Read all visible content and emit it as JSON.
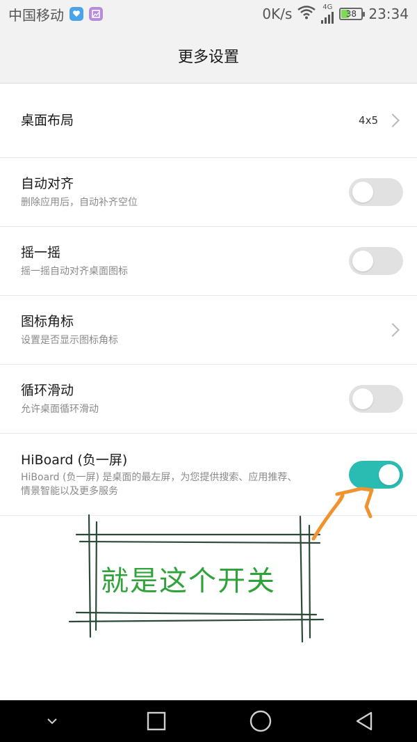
{
  "status_bar": {
    "carrier": "中国移动",
    "network_speed": "0K/s",
    "network_type": "4G",
    "battery_level": "38",
    "battery_fraction": 0.38,
    "time": "23:34",
    "icons": [
      "app-notification-icon",
      "gallery-icon",
      "wifi-icon",
      "signal-icon",
      "battery-icon"
    ]
  },
  "header": {
    "title": "更多设置"
  },
  "settings": [
    {
      "title": "桌面布局",
      "subtitle": "",
      "value": "4x5",
      "control": "chevron"
    },
    {
      "title": "自动对齐",
      "subtitle": "删除应用后，自动补齐空位",
      "control": "toggle",
      "on": false
    },
    {
      "title": "摇一摇",
      "subtitle": "摇一摇自动对齐桌面图标",
      "control": "toggle",
      "on": false
    },
    {
      "title": "图标角标",
      "subtitle": "设置是否显示图标角标",
      "control": "chevron"
    },
    {
      "title": "循环滑动",
      "subtitle": "允许桌面循环滑动",
      "control": "toggle",
      "on": false
    },
    {
      "title": "HiBoard (负一屏)",
      "subtitle_line1": "HiBoard (负一屏) 是桌面的最左屏，为您提供搜索、应用推荐、",
      "subtitle_line2": "情景智能以及更多服务",
      "control": "toggle",
      "on": true
    }
  ],
  "annotation": {
    "text": "就是这个开关",
    "color": "#2fa339",
    "arrow_color": "#f0922e"
  },
  "nav_bar": {
    "icons": [
      "collapse-icon",
      "recent-apps-icon",
      "home-icon",
      "back-icon"
    ]
  },
  "colors": {
    "toggle_on": "#2abbb3",
    "toggle_off": "#e1e1e1",
    "header_bg": "#f2f2f2"
  }
}
